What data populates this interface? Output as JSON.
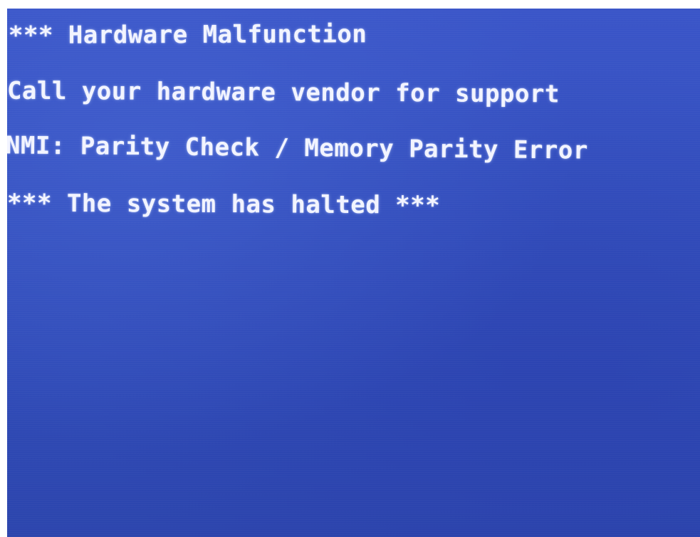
{
  "bsod": {
    "background_color": "#3450bf",
    "text_color": "#f2f4ff",
    "lines": {
      "line1": "*** Hardware Malfunction",
      "line2": "Call your hardware vendor for support",
      "line3": "NMI: Parity Check / Memory Parity Error",
      "line4": "*** The system has halted ***"
    }
  }
}
